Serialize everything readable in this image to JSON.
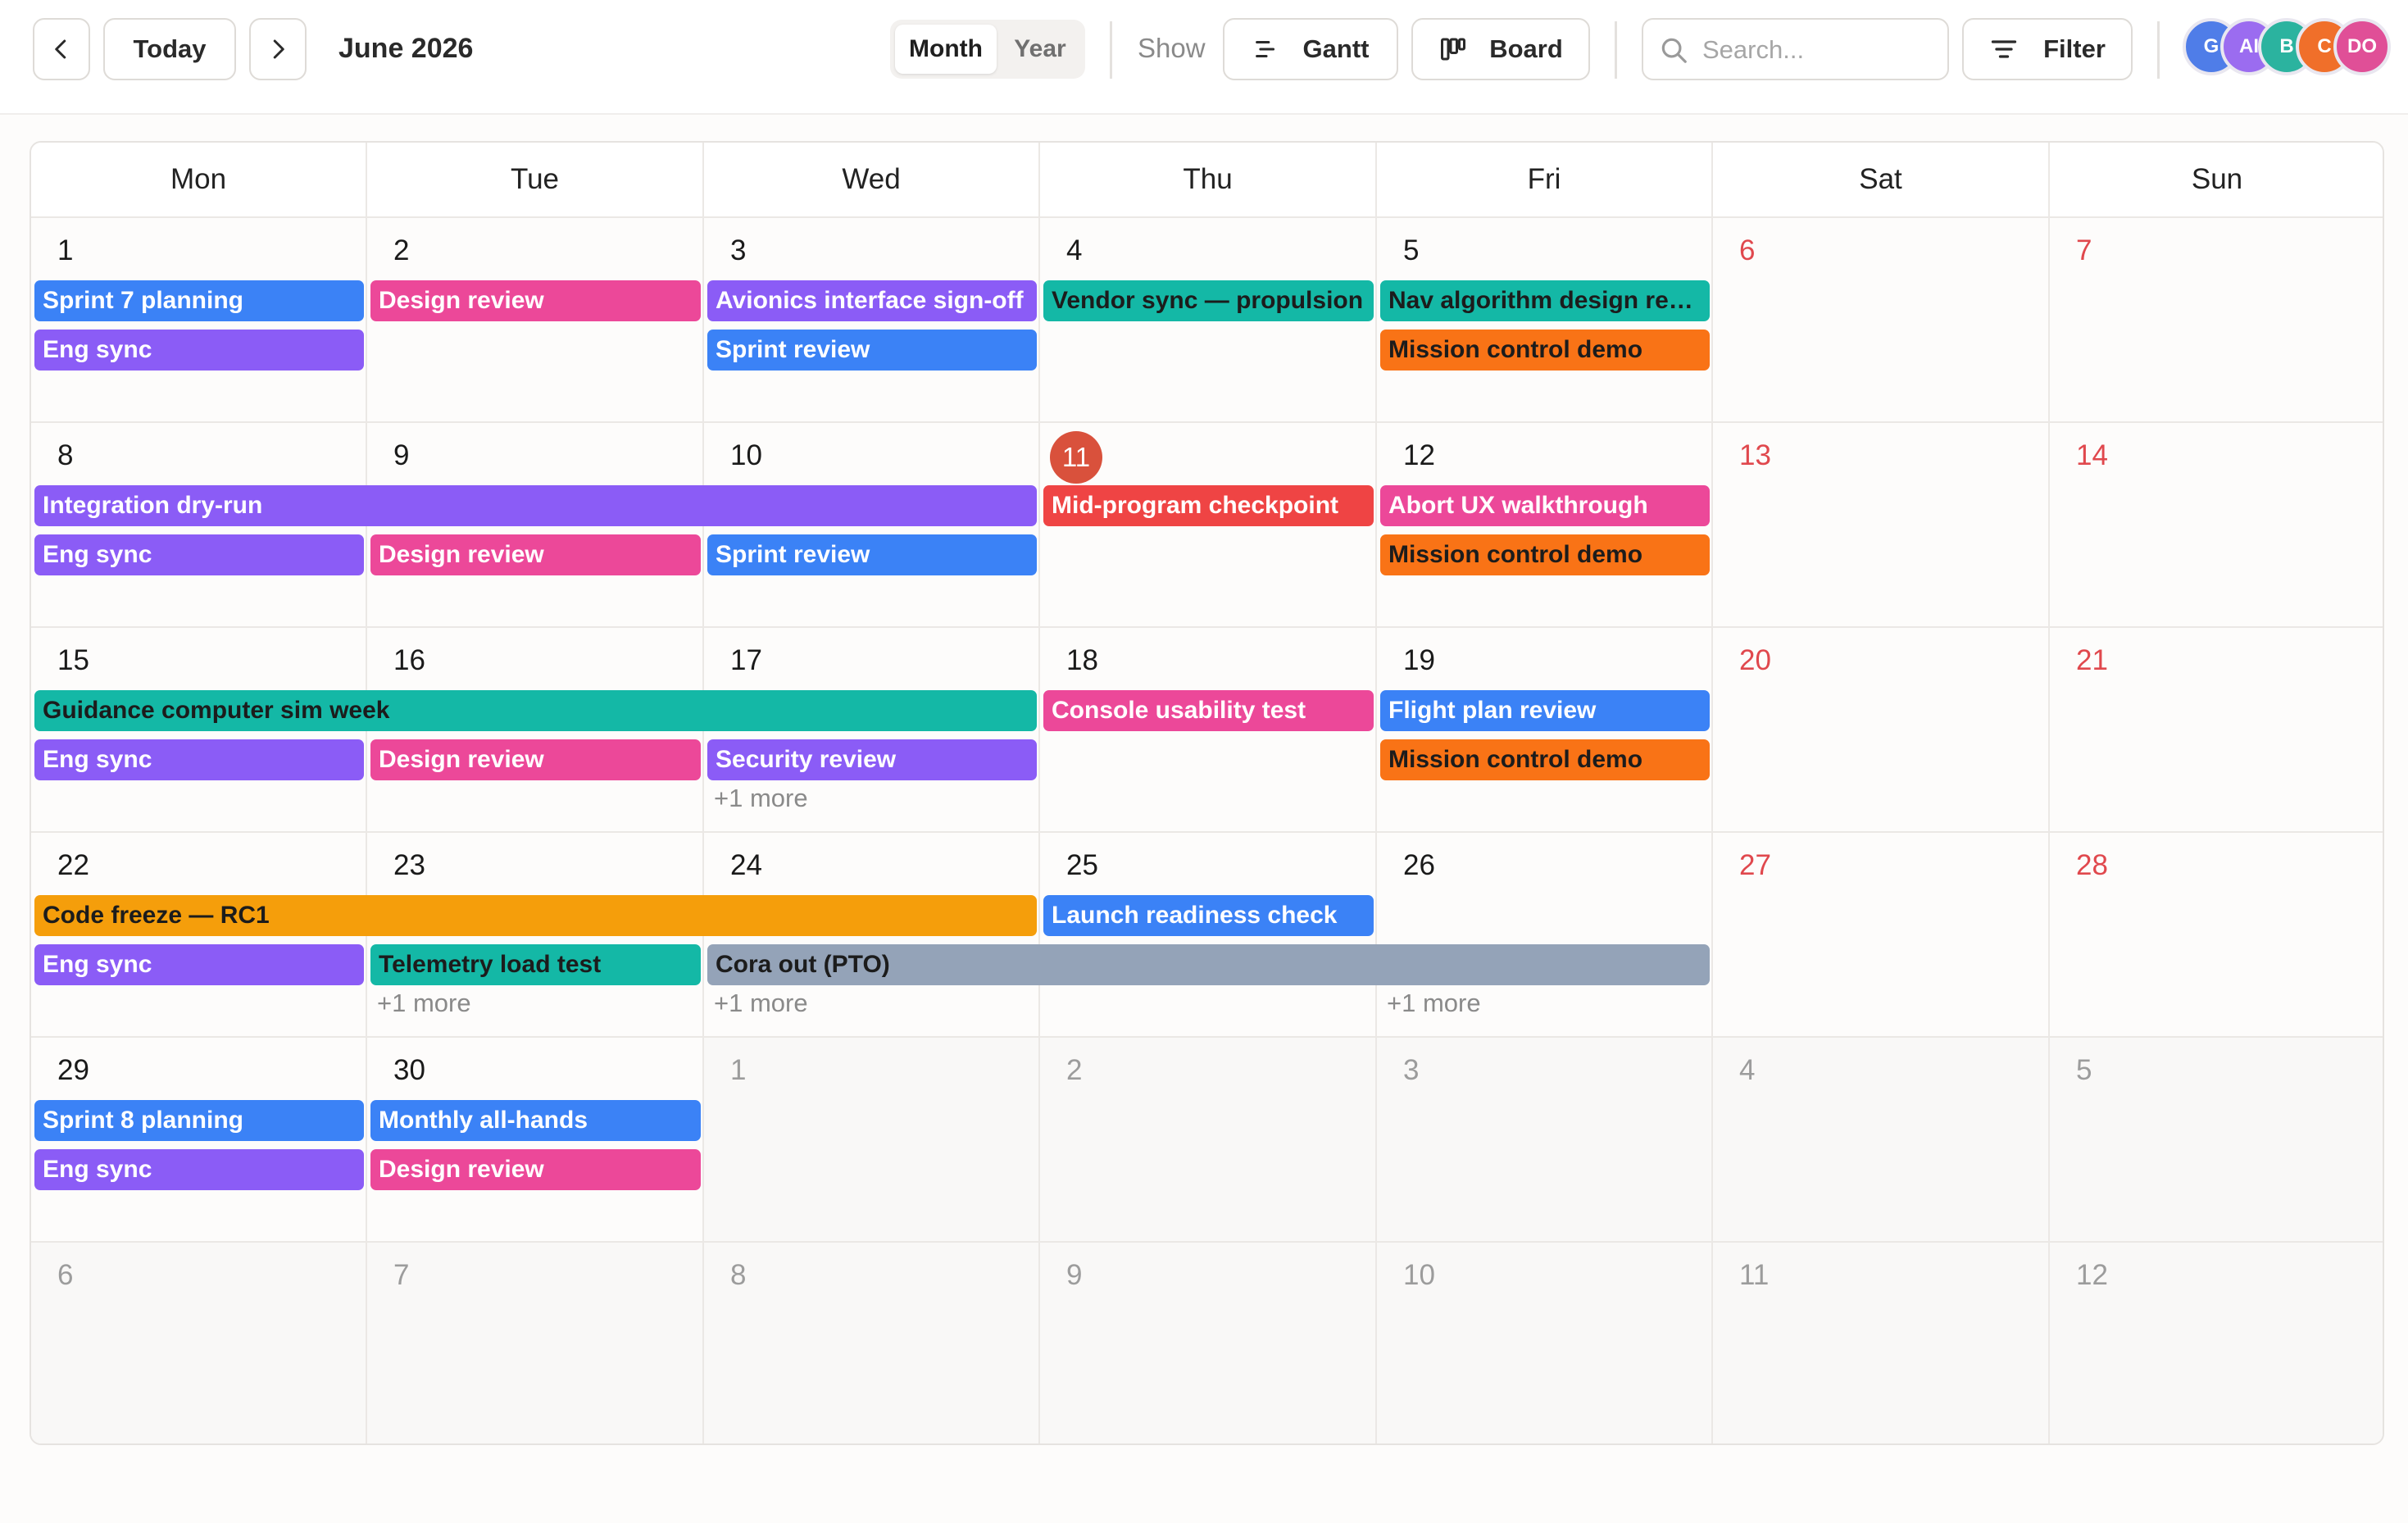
{
  "header": {
    "today_label": "Today",
    "title": "June 2026",
    "view_tabs": [
      {
        "label": "Month",
        "active": true
      },
      {
        "label": "Year",
        "active": false
      }
    ],
    "show_label": "Show",
    "gantt_label": "Gantt",
    "board_label": "Board",
    "search_placeholder": "Search...",
    "filter_label": "Filter",
    "avatars": [
      {
        "initials": "G",
        "color": "#4f7de8"
      },
      {
        "initials": "AI",
        "color": "#9b6cf0"
      },
      {
        "initials": "B",
        "color": "#2bb39f"
      },
      {
        "initials": "C",
        "color": "#f06f2a"
      },
      {
        "initials": "DO",
        "color": "#e04f97"
      }
    ]
  },
  "weekdays": [
    "Mon",
    "Tue",
    "Wed",
    "Thu",
    "Fri",
    "Sat",
    "Sun"
  ],
  "weeks": [
    [
      "1",
      "2",
      "3",
      "4",
      "5",
      "6",
      "7"
    ],
    [
      "8",
      "9",
      "10",
      "11",
      "12",
      "13",
      "14"
    ],
    [
      "15",
      "16",
      "17",
      "18",
      "19",
      "20",
      "21"
    ],
    [
      "22",
      "23",
      "24",
      "25",
      "26",
      "27",
      "28"
    ],
    [
      "29",
      "30",
      "1",
      "2",
      "3",
      "4",
      "5"
    ],
    [
      "6",
      "7",
      "8",
      "9",
      "10",
      "11",
      "12"
    ]
  ],
  "today": {
    "week": 1,
    "day": 3
  },
  "colors": {
    "blue": "#3b82f6",
    "purple": "#8b5cf6",
    "pink": "#ec4899",
    "teal": "#14b8a6",
    "orange": "#f97316",
    "red": "#ef4444",
    "amber": "#f59e0b",
    "gray": "#94a3b8",
    "weekend": "#e0484d",
    "today": "#d9513c"
  },
  "events": [
    {
      "title": "Sprint 7 planning",
      "week": 0,
      "start": 0,
      "span": 1,
      "row": 0,
      "color": "blue",
      "text": "light"
    },
    {
      "title": "Eng sync",
      "week": 0,
      "start": 0,
      "span": 1,
      "row": 1,
      "color": "purple",
      "text": "light"
    },
    {
      "title": "Design review",
      "week": 0,
      "start": 1,
      "span": 1,
      "row": 0,
      "color": "pink",
      "text": "light"
    },
    {
      "title": "Avionics interface sign-off",
      "week": 0,
      "start": 2,
      "span": 1,
      "row": 0,
      "color": "purple",
      "text": "light"
    },
    {
      "title": "Sprint review",
      "week": 0,
      "start": 2,
      "span": 1,
      "row": 1,
      "color": "blue",
      "text": "light"
    },
    {
      "title": "Vendor sync — propulsion",
      "week": 0,
      "start": 3,
      "span": 1,
      "row": 0,
      "color": "teal",
      "text": "dark"
    },
    {
      "title": "Nav algorithm design review",
      "week": 0,
      "start": 4,
      "span": 1,
      "row": 0,
      "color": "teal",
      "text": "dark"
    },
    {
      "title": "Mission control demo",
      "week": 0,
      "start": 4,
      "span": 1,
      "row": 1,
      "color": "orange",
      "text": "dark"
    },
    {
      "title": "Integration dry-run",
      "week": 1,
      "start": 0,
      "span": 3,
      "row": 0,
      "color": "purple",
      "text": "light"
    },
    {
      "title": "Eng sync",
      "week": 1,
      "start": 0,
      "span": 1,
      "row": 1,
      "color": "purple",
      "text": "light"
    },
    {
      "title": "Design review",
      "week": 1,
      "start": 1,
      "span": 1,
      "row": 1,
      "color": "pink",
      "text": "light"
    },
    {
      "title": "Sprint review",
      "week": 1,
      "start": 2,
      "span": 1,
      "row": 1,
      "color": "blue",
      "text": "light"
    },
    {
      "title": "Mid-program checkpoint",
      "week": 1,
      "start": 3,
      "span": 1,
      "row": 0,
      "color": "red",
      "text": "light"
    },
    {
      "title": "Abort UX walkthrough",
      "week": 1,
      "start": 4,
      "span": 1,
      "row": 0,
      "color": "pink",
      "text": "light"
    },
    {
      "title": "Mission control demo",
      "week": 1,
      "start": 4,
      "span": 1,
      "row": 1,
      "color": "orange",
      "text": "dark"
    },
    {
      "title": "Guidance computer sim week",
      "week": 2,
      "start": 0,
      "span": 3,
      "row": 0,
      "color": "teal",
      "text": "dark"
    },
    {
      "title": "Eng sync",
      "week": 2,
      "start": 0,
      "span": 1,
      "row": 1,
      "color": "purple",
      "text": "light"
    },
    {
      "title": "Design review",
      "week": 2,
      "start": 1,
      "span": 1,
      "row": 1,
      "color": "pink",
      "text": "light"
    },
    {
      "title": "Security review",
      "week": 2,
      "start": 2,
      "span": 1,
      "row": 1,
      "color": "purple",
      "text": "light"
    },
    {
      "title": "Console usability test",
      "week": 2,
      "start": 3,
      "span": 1,
      "row": 0,
      "color": "pink",
      "text": "light"
    },
    {
      "title": "Flight plan review",
      "week": 2,
      "start": 4,
      "span": 1,
      "row": 0,
      "color": "blue",
      "text": "light"
    },
    {
      "title": "Mission control demo",
      "week": 2,
      "start": 4,
      "span": 1,
      "row": 1,
      "color": "orange",
      "text": "dark"
    },
    {
      "title": "Code freeze — RC1",
      "week": 3,
      "start": 0,
      "span": 3,
      "row": 0,
      "color": "amber",
      "text": "dark"
    },
    {
      "title": "Eng sync",
      "week": 3,
      "start": 0,
      "span": 1,
      "row": 1,
      "color": "purple",
      "text": "light"
    },
    {
      "title": "Telemetry load test",
      "week": 3,
      "start": 1,
      "span": 1,
      "row": 1,
      "color": "teal",
      "text": "dark"
    },
    {
      "title": "Cora out (PTO)",
      "week": 3,
      "start": 2,
      "span": 3,
      "row": 1,
      "color": "gray",
      "text": "dark"
    },
    {
      "title": "Launch readiness check",
      "week": 3,
      "start": 3,
      "span": 1,
      "row": 0,
      "color": "blue",
      "text": "light"
    },
    {
      "title": "Sprint 8 planning",
      "week": 4,
      "start": 0,
      "span": 1,
      "row": 0,
      "color": "blue",
      "text": "light"
    },
    {
      "title": "Eng sync",
      "week": 4,
      "start": 0,
      "span": 1,
      "row": 1,
      "color": "purple",
      "text": "light"
    },
    {
      "title": "Monthly all-hands",
      "week": 4,
      "start": 1,
      "span": 1,
      "row": 0,
      "color": "blue",
      "text": "light"
    },
    {
      "title": "Design review",
      "week": 4,
      "start": 1,
      "span": 1,
      "row": 1,
      "color": "pink",
      "text": "light"
    }
  ],
  "more_links": [
    {
      "label": "+1 more",
      "week": 2,
      "day": 2
    },
    {
      "label": "+1 more",
      "week": 3,
      "day": 1
    },
    {
      "label": "+1 more",
      "week": 3,
      "day": 2
    },
    {
      "label": "+1 more",
      "week": 3,
      "day": 4
    }
  ]
}
